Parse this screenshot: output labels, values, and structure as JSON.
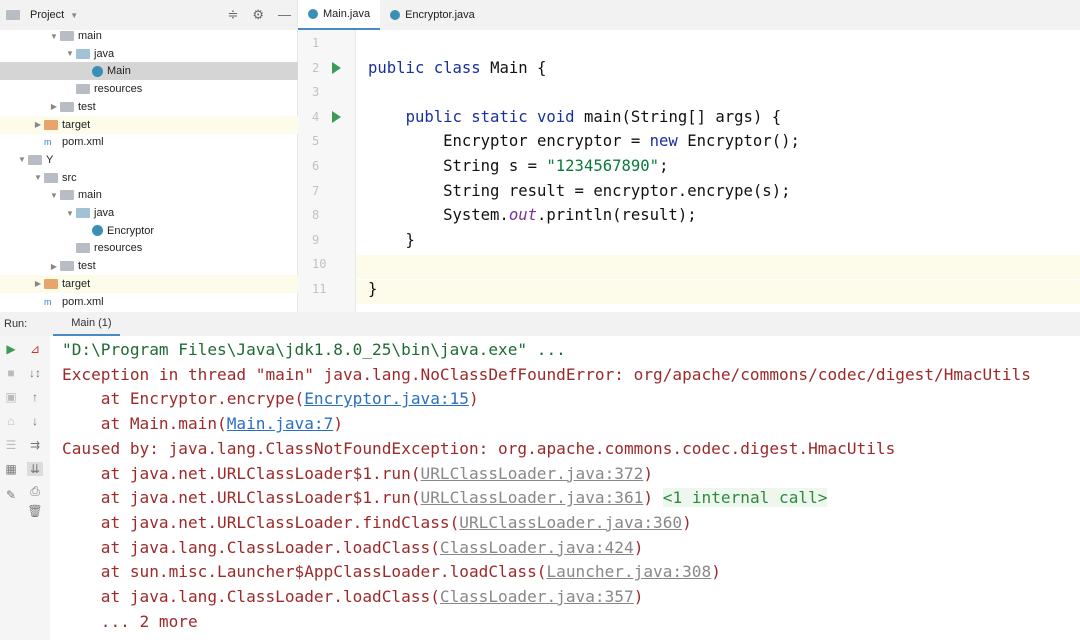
{
  "project": {
    "title": "Project",
    "tree": [
      {
        "label": "main",
        "indent": 3,
        "arrow": "▼",
        "icon": "folder"
      },
      {
        "label": "java",
        "indent": 4,
        "arrow": "▼",
        "icon": "src"
      },
      {
        "label": "Main",
        "indent": 5,
        "arrow": "",
        "icon": "class",
        "selected": true
      },
      {
        "label": "resources",
        "indent": 4,
        "arrow": "",
        "icon": "folder"
      },
      {
        "label": "test",
        "indent": 3,
        "arrow": "▶",
        "icon": "folder"
      },
      {
        "label": "target",
        "indent": 2,
        "arrow": "▶",
        "icon": "target",
        "highlight": true
      },
      {
        "label": "pom.xml",
        "indent": 2,
        "arrow": "",
        "icon": "xml"
      },
      {
        "label": "Y",
        "indent": 1,
        "arrow": "▼",
        "icon": "folder"
      },
      {
        "label": "src",
        "indent": 2,
        "arrow": "▼",
        "icon": "folder"
      },
      {
        "label": "main",
        "indent": 3,
        "arrow": "▼",
        "icon": "folder"
      },
      {
        "label": "java",
        "indent": 4,
        "arrow": "▼",
        "icon": "src"
      },
      {
        "label": "Encryptor",
        "indent": 5,
        "arrow": "",
        "icon": "class"
      },
      {
        "label": "resources",
        "indent": 4,
        "arrow": "",
        "icon": "folder"
      },
      {
        "label": "test",
        "indent": 3,
        "arrow": "▶",
        "icon": "folder"
      },
      {
        "label": "target",
        "indent": 2,
        "arrow": "▶",
        "icon": "target",
        "highlight": true
      },
      {
        "label": "pom.xml",
        "indent": 2,
        "arrow": "",
        "icon": "xml"
      }
    ]
  },
  "tabs": [
    {
      "label": "Main.java",
      "active": true
    },
    {
      "label": "Encryptor.java",
      "active": false
    }
  ],
  "editor": {
    "line_numbers": [
      "1",
      "2",
      "3",
      "4",
      "5",
      "6",
      "7",
      "8",
      "9",
      "10",
      "11"
    ],
    "run_lines": [
      2,
      4
    ],
    "lines": [
      [],
      [
        [
          "kw",
          "public class "
        ],
        [
          "",
          "Main "
        ],
        [
          "",
          "{"
        ]
      ],
      [],
      [
        [
          "",
          "    "
        ],
        [
          "kw",
          "public static void "
        ],
        [
          "",
          "main(String[] args) {"
        ]
      ],
      [
        [
          "",
          "        Encryptor encryptor = "
        ],
        [
          "kw",
          "new "
        ],
        [
          "",
          "Encryptor();"
        ]
      ],
      [
        [
          "",
          "        String s = "
        ],
        [
          "str",
          "\"1234567890\""
        ],
        [
          "",
          ";"
        ]
      ],
      [
        [
          "",
          "        String result = encryptor.encrype(s);"
        ]
      ],
      [
        [
          "",
          "        System."
        ],
        [
          "it",
          "out"
        ],
        [
          "",
          ".println(result);"
        ]
      ],
      [
        [
          "",
          "    }"
        ]
      ],
      [],
      [
        [
          "",
          "}"
        ]
      ]
    ]
  },
  "run": {
    "label": "Run:",
    "tab": "Main (1)"
  },
  "console": [
    {
      "cls": "cmd",
      "segs": [
        [
          "",
          "\"D:\\Program Files\\Java\\jdk1.8.0_25\\bin\\java.exe\" ..."
        ]
      ]
    },
    {
      "segs": [
        [
          "",
          "Exception in thread \"main\" java.lang.NoClassDefFoundError: org/apache/commons/codec/digest/HmacUtils"
        ]
      ]
    },
    {
      "segs": [
        [
          "",
          "    at Encryptor.encrype("
        ],
        [
          "lk",
          "Encryptor.java:15"
        ],
        [
          "",
          ")"
        ]
      ]
    },
    {
      "segs": [
        [
          "",
          "    at Main.main("
        ],
        [
          "lk",
          "Main.java:7"
        ],
        [
          "",
          ")"
        ]
      ]
    },
    {
      "segs": [
        [
          "",
          "Caused by: java.lang.ClassNotFoundException: org.apache.commons.codec.digest.HmacUtils"
        ]
      ]
    },
    {
      "segs": [
        [
          "",
          "    at java.net.URLClassLoader$1.run("
        ],
        [
          "gl",
          "URLClassLoader.java:372"
        ],
        [
          "",
          ")"
        ]
      ]
    },
    {
      "segs": [
        [
          "",
          "    at java.net.URLClassLoader$1.run("
        ],
        [
          "gl",
          "URLClassLoader.java:361"
        ],
        [
          "",
          ") "
        ],
        [
          "nt",
          "<1 internal call>"
        ]
      ]
    },
    {
      "segs": [
        [
          "",
          "    at java.net.URLClassLoader.findClass("
        ],
        [
          "gl",
          "URLClassLoader.java:360"
        ],
        [
          "",
          ")"
        ]
      ]
    },
    {
      "segs": [
        [
          "",
          "    at java.lang.ClassLoader.loadClass("
        ],
        [
          "gl",
          "ClassLoader.java:424"
        ],
        [
          "",
          ")"
        ]
      ]
    },
    {
      "segs": [
        [
          "",
          "    at sun.misc.Launcher$AppClassLoader.loadClass("
        ],
        [
          "gl",
          "Launcher.java:308"
        ],
        [
          "",
          ")"
        ]
      ]
    },
    {
      "segs": [
        [
          "",
          "    at java.lang.ClassLoader.loadClass("
        ],
        [
          "gl",
          "ClassLoader.java:357"
        ],
        [
          "",
          ")"
        ]
      ]
    },
    {
      "segs": [
        [
          "",
          "    ... 2 more"
        ]
      ]
    }
  ]
}
